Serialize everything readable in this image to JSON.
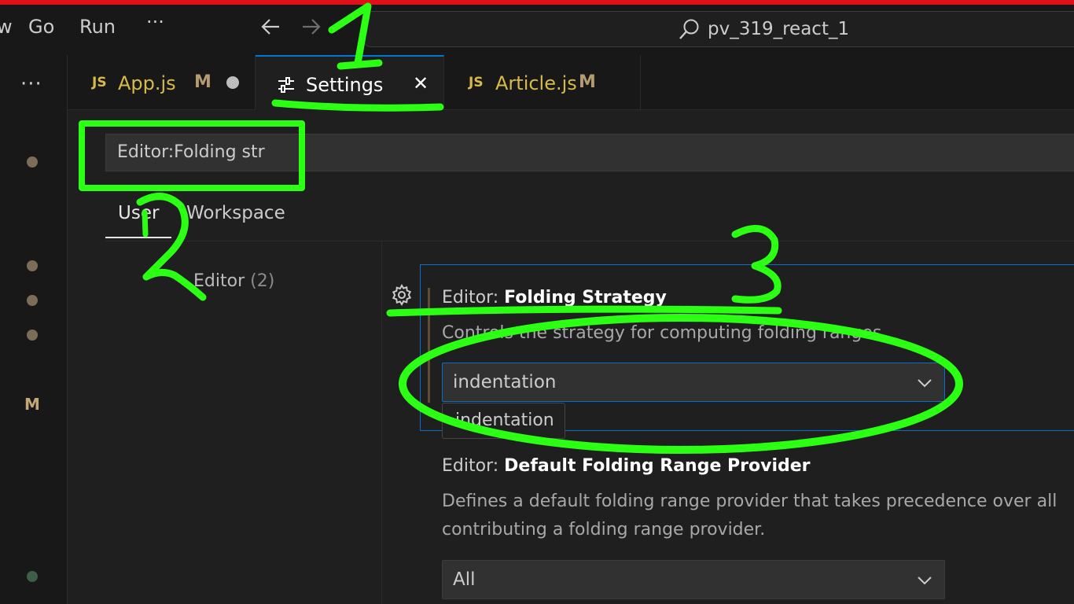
{
  "menu": [
    "Go",
    "Run",
    "···"
  ],
  "menu_partial": "w",
  "command_center": {
    "text": "pv_319_react_1"
  },
  "activity": {
    "more": "···",
    "badge": "M"
  },
  "tabs": [
    {
      "icon": "JS",
      "label": "App.js",
      "status": "M",
      "dirty": true,
      "color": "#d7ba4a"
    },
    {
      "label": "Settings",
      "close": "✕",
      "active": true
    },
    {
      "icon": "JS",
      "label": "Article.js",
      "status": "M",
      "color": "#d7ba4a"
    }
  ],
  "settings": {
    "search": {
      "value": "Editor:Folding str"
    },
    "scopes": [
      "User",
      "Workspace"
    ],
    "toc": {
      "label": "Editor",
      "count": "(2)"
    },
    "items": [
      {
        "category": "Editor: ",
        "name": "Folding Strategy",
        "description": "Controls the strategy for computing folding ranges.",
        "value": "indentation",
        "dropdown_option": "indentation"
      },
      {
        "category": "Editor: ",
        "name": "Default Folding Range Provider",
        "description_line1": "Defines a default folding range provider that takes precedence over all",
        "description_line2": "contributing a folding range provider.",
        "value": "All"
      }
    ]
  },
  "annotations": [
    "1",
    "2",
    "3"
  ],
  "colors": {
    "annotation": "#2bff14",
    "accent": "#0078d4",
    "modified": "#c5a877"
  }
}
